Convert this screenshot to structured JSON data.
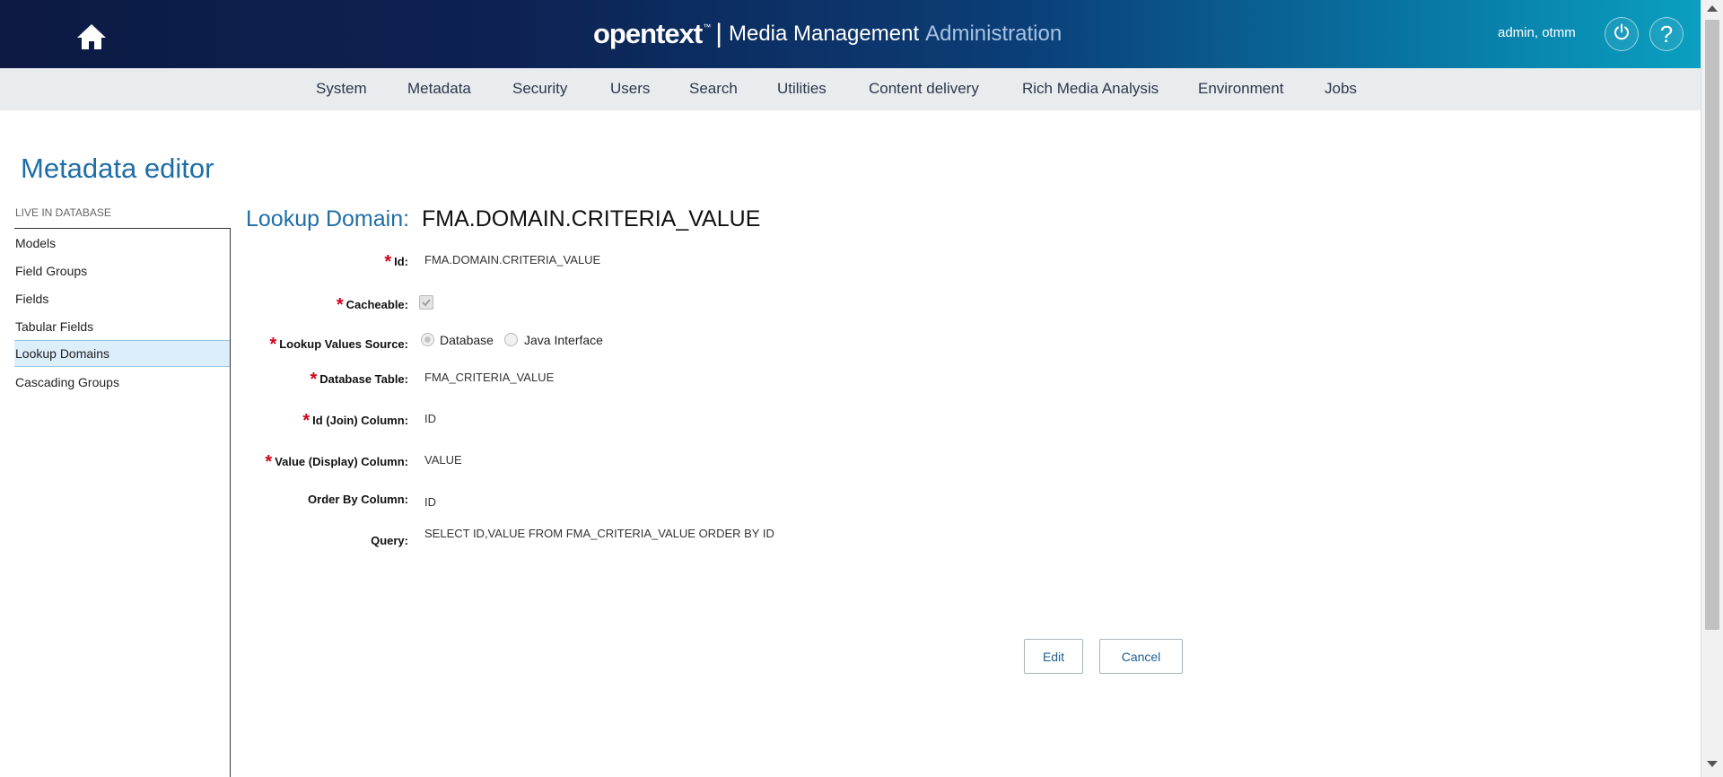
{
  "header": {
    "brand_logo": "opentext",
    "brand_tm": "™",
    "brand_separator": "|",
    "brand_title": "Media Management",
    "brand_subtitle": "Administration",
    "user": "admin, otmm",
    "help_symbol": "?",
    "icons": [
      "home-icon",
      "power-icon",
      "help-icon"
    ]
  },
  "nav": {
    "items": [
      {
        "label": "System"
      },
      {
        "label": "Metadata"
      },
      {
        "label": "Security"
      },
      {
        "label": "Users"
      },
      {
        "label": "Search"
      },
      {
        "label": "Utilities"
      },
      {
        "label": "Content delivery"
      },
      {
        "label": "Rich Media Analysis"
      },
      {
        "label": "Environment"
      },
      {
        "label": "Jobs"
      }
    ]
  },
  "page": {
    "title": "Metadata editor"
  },
  "sidebar": {
    "heading": "LIVE IN DATABASE",
    "items": [
      {
        "label": "Models"
      },
      {
        "label": "Field Groups"
      },
      {
        "label": "Fields"
      },
      {
        "label": "Tabular Fields"
      },
      {
        "label": "Lookup Domains",
        "active": true
      },
      {
        "label": "Cascading Groups"
      }
    ]
  },
  "form": {
    "heading_label": "Lookup Domain:",
    "heading_value": "FMA.DOMAIN.CRITERIA_VALUE",
    "required_marker": "*",
    "fields": {
      "id": {
        "label": "Id:",
        "value": "FMA.DOMAIN.CRITERIA_VALUE"
      },
      "cacheable": {
        "label": "Cacheable:",
        "checked": true
      },
      "source": {
        "label": "Lookup Values Source:",
        "options": [
          "Database",
          "Java Interface"
        ],
        "selected": "Database"
      },
      "table": {
        "label": "Database Table:",
        "value": "FMA_CRITERIA_VALUE"
      },
      "join": {
        "label": "Id (Join) Column:",
        "value": "ID"
      },
      "display": {
        "label": "Value (Display) Column:",
        "value": "VALUE"
      },
      "order": {
        "label": "Order By Column:",
        "value": "ID"
      },
      "query": {
        "label": "Query:",
        "value": "SELECT ID,VALUE FROM FMA_CRITERIA_VALUE ORDER BY ID"
      }
    },
    "buttons": {
      "edit": "Edit",
      "cancel": "Cancel"
    }
  },
  "colors": {
    "accent": "#1f6ea6",
    "required": "#d0021b",
    "nav_bg": "#e8ecef",
    "active_item_bg": "#ddeefb"
  }
}
